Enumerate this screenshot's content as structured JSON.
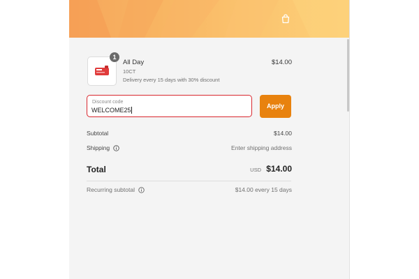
{
  "cart": {
    "icon": "shopping-bag-icon"
  },
  "product": {
    "quantity": "1",
    "title": "All Day",
    "variant": "10CT",
    "plan": "Delivery every 15 days with 30% discount",
    "price": "$14.00",
    "thumbnail_icon": "product-thumbnail"
  },
  "discount": {
    "label": "Discount code",
    "value": "WELCOME25",
    "apply_label": "Apply"
  },
  "summary": {
    "subtotal_label": "Subtotal",
    "subtotal_value": "$14.00",
    "shipping_label": "Shipping",
    "shipping_value": "Enter shipping address",
    "total_label": "Total",
    "total_currency": "USD",
    "total_value": "$14.00",
    "recurring_label": "Recurring subtotal",
    "recurring_value": "$14.00 every 15 days"
  },
  "colors": {
    "accent": "#e8820e",
    "error_border": "#d9272e",
    "banner_start": "#f6a65b",
    "banner_end": "#fcd079"
  }
}
